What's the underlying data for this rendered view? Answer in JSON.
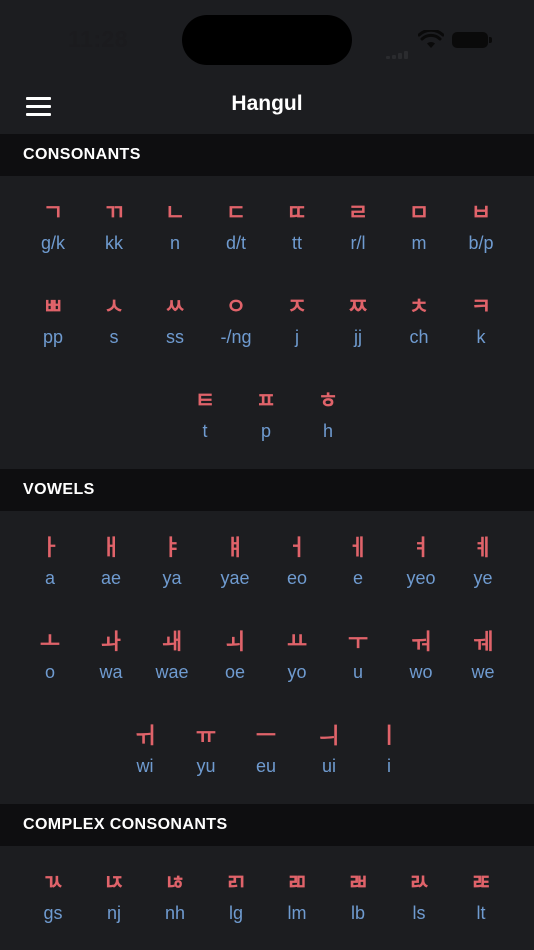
{
  "status_bar": {
    "time": "11:28"
  },
  "nav": {
    "title": "Hangul",
    "menu_icon": "hamburger-menu-icon"
  },
  "colors": {
    "background": "#1c1d20",
    "header_band": "#0e0e10",
    "glyph": "#e0636a",
    "romanization": "#6f9bd0"
  },
  "sections": {
    "consonants": {
      "title": "CONSONANTS",
      "rows": [
        [
          {
            "g": "ㄱ",
            "r": "g/k"
          },
          {
            "g": "ㄲ",
            "r": "kk"
          },
          {
            "g": "ㄴ",
            "r": "n"
          },
          {
            "g": "ㄷ",
            "r": "d/t"
          },
          {
            "g": "ㄸ",
            "r": "tt"
          },
          {
            "g": "ㄹ",
            "r": "r/l"
          },
          {
            "g": "ㅁ",
            "r": "m"
          },
          {
            "g": "ㅂ",
            "r": "b/p"
          }
        ],
        [
          {
            "g": "ㅃ",
            "r": "pp"
          },
          {
            "g": "ㅅ",
            "r": "s"
          },
          {
            "g": "ㅆ",
            "r": "ss"
          },
          {
            "g": "ㅇ",
            "r": "-/ng"
          },
          {
            "g": "ㅈ",
            "r": "j"
          },
          {
            "g": "ㅉ",
            "r": "jj"
          },
          {
            "g": "ㅊ",
            "r": "ch"
          },
          {
            "g": "ㅋ",
            "r": "k"
          }
        ],
        [
          {
            "g": "ㅌ",
            "r": "t"
          },
          {
            "g": "ㅍ",
            "r": "p"
          },
          {
            "g": "ㅎ",
            "r": "h"
          }
        ]
      ]
    },
    "vowels": {
      "title": "VOWELS",
      "rows": [
        [
          {
            "g": "ㅏ",
            "r": "a"
          },
          {
            "g": "ㅐ",
            "r": "ae"
          },
          {
            "g": "ㅑ",
            "r": "ya"
          },
          {
            "g": "ㅒ",
            "r": "yae"
          },
          {
            "g": "ㅓ",
            "r": "eo"
          },
          {
            "g": "ㅔ",
            "r": "e"
          },
          {
            "g": "ㅕ",
            "r": "yeo"
          },
          {
            "g": "ㅖ",
            "r": "ye"
          }
        ],
        [
          {
            "g": "ㅗ",
            "r": "o"
          },
          {
            "g": "ㅘ",
            "r": "wa"
          },
          {
            "g": "ㅙ",
            "r": "wae"
          },
          {
            "g": "ㅚ",
            "r": "oe"
          },
          {
            "g": "ㅛ",
            "r": "yo"
          },
          {
            "g": "ㅜ",
            "r": "u"
          },
          {
            "g": "ㅝ",
            "r": "wo"
          },
          {
            "g": "ㅞ",
            "r": "we"
          }
        ],
        [
          {
            "g": "ㅟ",
            "r": "wi"
          },
          {
            "g": "ㅠ",
            "r": "yu"
          },
          {
            "g": "ㅡ",
            "r": "eu"
          },
          {
            "g": "ㅢ",
            "r": "ui"
          },
          {
            "g": "ㅣ",
            "r": "i"
          }
        ]
      ]
    },
    "complex_consonants": {
      "title": "COMPLEX CONSONANTS",
      "rows": [
        [
          {
            "g": "ㄳ",
            "r": "gs"
          },
          {
            "g": "ㄵ",
            "r": "nj"
          },
          {
            "g": "ㄶ",
            "r": "nh"
          },
          {
            "g": "ㄺ",
            "r": "lg"
          },
          {
            "g": "ㄻ",
            "r": "lm"
          },
          {
            "g": "ㄼ",
            "r": "lb"
          },
          {
            "g": "ㄽ",
            "r": "ls"
          },
          {
            "g": "ㄾ",
            "r": "lt"
          }
        ]
      ]
    }
  }
}
